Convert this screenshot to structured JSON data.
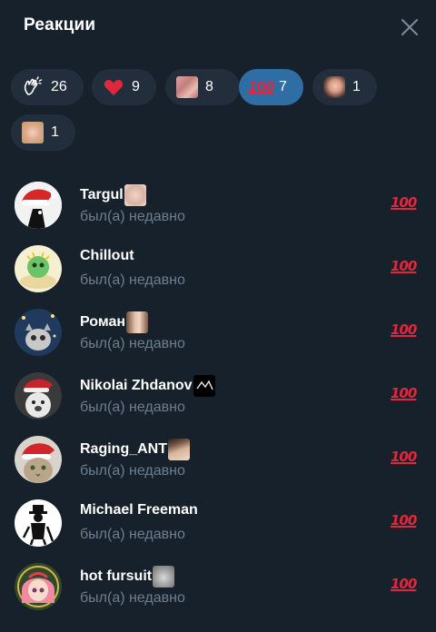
{
  "header": {
    "title": "Реакции",
    "close_icon": "close-icon"
  },
  "filters": [
    {
      "icon": "clap-icon",
      "count": "26",
      "active": false
    },
    {
      "icon": "heart-icon",
      "count": "9",
      "active": false
    },
    {
      "icon": "sticker-skin-icon",
      "count": "8",
      "active": false
    },
    {
      "icon": "hundred-points-icon",
      "count": "7",
      "active": true
    },
    {
      "icon": "sticker-face-icon",
      "count": "1",
      "active": false
    },
    {
      "icon": "sticker-face2-icon",
      "count": "1",
      "active": false
    }
  ],
  "users": [
    {
      "name": "Targul",
      "status": "был(а) недавно",
      "reaction": "hundred-points-icon"
    },
    {
      "name": "Chillout",
      "status": "был(а) недавно",
      "reaction": "hundred-points-icon"
    },
    {
      "name": "Роман",
      "status": "был(а) недавно",
      "reaction": "hundred-points-icon"
    },
    {
      "name": "Nikolai Zhdanov",
      "status": "был(а) недавно",
      "reaction": "hundred-points-icon"
    },
    {
      "name": "Raging_ANT",
      "status": "был(а) недавно",
      "reaction": "hundred-points-icon"
    },
    {
      "name": "Michael Freeman",
      "status": "был(а) недавно",
      "reaction": "hundred-points-icon"
    },
    {
      "name": "hot fursuit",
      "status": "был(а) недавно",
      "reaction": "hundred-points-icon"
    }
  ],
  "colors": {
    "background": "#17212b",
    "chip": "#232e3c",
    "chip_active": "#2f6ea5",
    "status_text": "#6d7f8f",
    "reaction_red": "#e0283c"
  }
}
